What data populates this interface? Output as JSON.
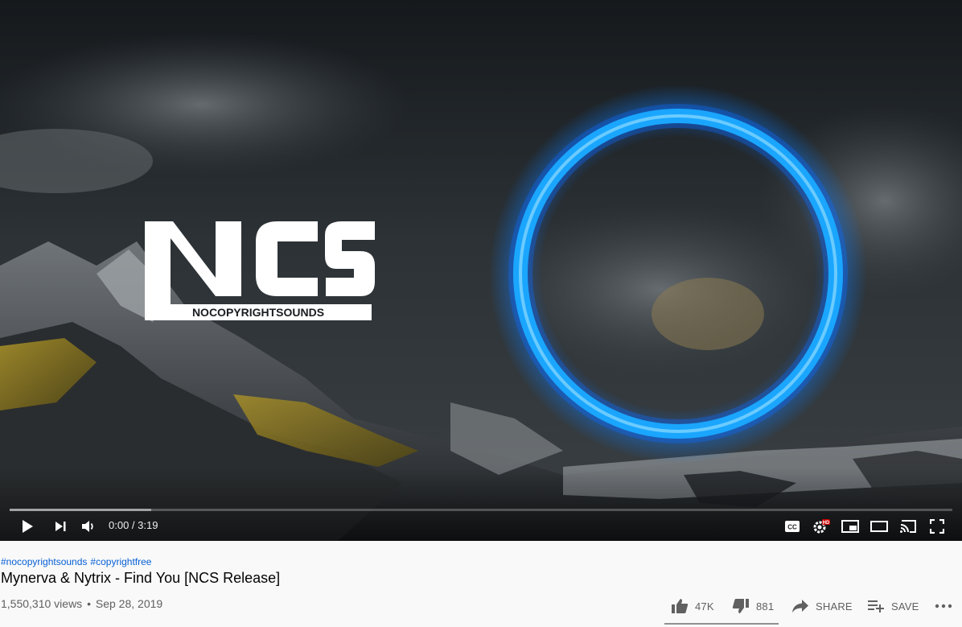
{
  "player": {
    "current_time": "0:00",
    "duration": "3:19",
    "time_separator": " / ",
    "progress_loaded_fraction": 0.15,
    "overlay_logo": {
      "mark": "NCS",
      "subtitle": "NOCOPYRIGHTSOUNDS"
    },
    "accent_ring_color": "#1aa6ff",
    "controls": {
      "left": [
        "play-icon",
        "next-icon",
        "volume-icon"
      ],
      "right": [
        "captions-icon",
        "settings-hd-icon",
        "miniplayer-icon",
        "theater-icon",
        "cast-icon",
        "fullscreen-icon"
      ]
    },
    "settings_badge": "HD"
  },
  "video": {
    "hashtags": [
      "#nocopyrightsounds",
      "#copyrightfree"
    ],
    "title": "Mynerva & Nytrix - Find You [NCS Release]",
    "views": "1,550,310 views",
    "separator": "•",
    "date": "Sep 28, 2019"
  },
  "actions": {
    "likes": "47K",
    "dislikes": "881",
    "share_label": "SHARE",
    "save_label": "SAVE",
    "like_ratio": 0.98
  },
  "colors": {
    "link": "#065fd4",
    "text_primary": "#030303",
    "text_secondary": "#606060",
    "page_bg": "#f9f9f9"
  }
}
